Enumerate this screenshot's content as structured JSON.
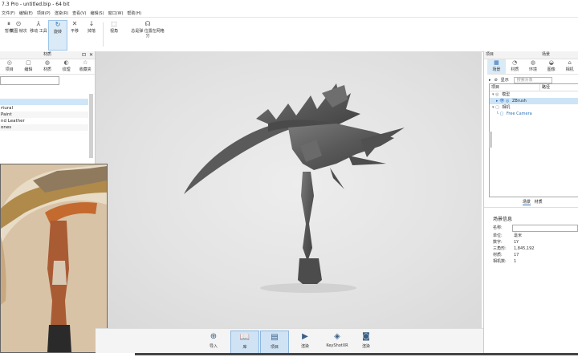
{
  "window": {
    "title": "7.3 Pro - untitled.bip - 64 bit"
  },
  "menu": [
    "文件(F)",
    "编辑(E)",
    "项目(P)",
    "渲染(R)",
    "查看(V)",
    "编辑(S)",
    "窗口(W)",
    "帮助(H)"
  ],
  "toolbar": {
    "items": [
      {
        "icon": "pause-icon",
        "glyph": "⏸",
        "label": "暂停"
      },
      {
        "icon": "screenshot-icon",
        "glyph": "⊙",
        "label": "截图 帧次"
      },
      {
        "icon": "move-tool-icon",
        "glyph": "⅄",
        "label": "移动 工具"
      },
      {
        "icon": "rotate-icon",
        "glyph": "↻",
        "label": "旋转"
      },
      {
        "icon": "translate-icon",
        "glyph": "✕",
        "label": "平移"
      },
      {
        "icon": "drop-icon",
        "glyph": "↓",
        "label": "掉落"
      },
      {
        "icon": "frame-icon",
        "glyph": "⬚",
        "label": "视角"
      },
      {
        "icon": "adjust-icon",
        "glyph": "☊",
        "label": "总是弹 位置在网格分"
      }
    ],
    "active_index": 3
  },
  "left_panel": {
    "title": "材质",
    "tabs": [
      {
        "glyph": "◎",
        "label": "项目"
      },
      {
        "glyph": "▢",
        "label": "编辑"
      },
      {
        "glyph": "◍",
        "label": "材质"
      },
      {
        "glyph": "◐",
        "label": "纹理"
      },
      {
        "glyph": "☆",
        "label": "收藏夹"
      }
    ],
    "materials": [
      "",
      "",
      "rtural",
      "Paint",
      "nd Leather",
      "ones"
    ],
    "selected_index": 1
  },
  "right_panel": {
    "top_labels": [
      "项目",
      "场景"
    ],
    "tabs": [
      {
        "glyph": "▦",
        "label": "场景"
      },
      {
        "glyph": "◔",
        "label": "材质"
      },
      {
        "glyph": "◍",
        "label": "环境"
      },
      {
        "glyph": "◒",
        "label": "图像"
      },
      {
        "glyph": "⌂",
        "label": "相机"
      }
    ],
    "toolbar": {
      "expand": "▸",
      "show_label": "显示",
      "search_placeholder": "搜索对象"
    },
    "tree_headers": [
      "项目",
      "路径"
    ],
    "tree": [
      {
        "label": "模型",
        "prefix": "▾ ◎"
      },
      {
        "label": "ZBrush",
        "prefix": "▸ 👁 ◎"
      },
      {
        "label": "相机",
        "prefix": "▾ ▢"
      },
      {
        "label": "Free Camera",
        "prefix": "└ ▢"
      }
    ],
    "bottom_tabs": [
      "场景",
      "材质"
    ],
    "scene_info": {
      "title": "场景信息",
      "rows": [
        {
          "label": "名称:",
          "value": ""
        },
        {
          "label": "单位:",
          "value": "毫米"
        },
        {
          "label": "数字:",
          "value": "1Y"
        },
        {
          "label": "三角形:",
          "value": "1,845,192"
        },
        {
          "label": "材质:",
          "value": "17"
        },
        {
          "label": "相机数:",
          "value": "1"
        }
      ]
    }
  },
  "bottom_bar": {
    "items": [
      {
        "icon": "import-icon",
        "glyph": "⊕",
        "label": "导入"
      },
      {
        "icon": "library-icon",
        "glyph": "📖",
        "label": "库"
      },
      {
        "icon": "project-icon",
        "glyph": "▤",
        "label": "项目"
      },
      {
        "icon": "render-icon",
        "glyph": "▶",
        "label": "渲染"
      },
      {
        "icon": "keyshotxr-icon",
        "glyph": "◈",
        "label": "KeyShotXR"
      },
      {
        "icon": "render-queue-icon",
        "glyph": "◙",
        "label": "渲染"
      }
    ],
    "active_indices": [
      1,
      2
    ]
  },
  "colors": {
    "accent": "#9cc5e8",
    "viewport_bg": "#e3e3e3",
    "model": "#5f5f5f",
    "selection": "#cfe6f8"
  }
}
